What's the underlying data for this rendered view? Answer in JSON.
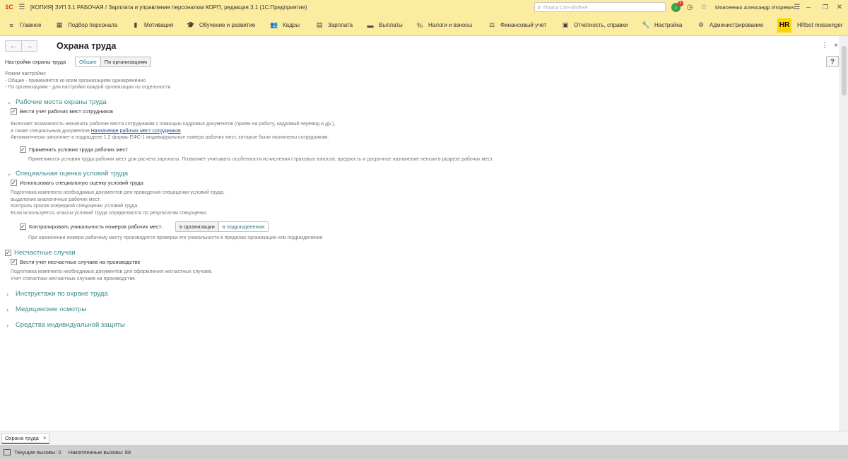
{
  "titlebar": {
    "logo": "1С",
    "title": "[КОПИЯ] ЗУП 3.1 РАБОЧАЯ / Зарплата и управление персоналом КОРП, редакция 3.1  (1С:Предприятие)",
    "search_placeholder": "Поиск Ctrl+Shift+F",
    "notifications_count": "3",
    "user": "Моисеенко Александр Игоревич"
  },
  "menu": {
    "items": [
      {
        "label": "Главное",
        "icon": "menu-icon"
      },
      {
        "label": "Подбор персонала",
        "icon": "recruiting-icon"
      },
      {
        "label": "Мотивация",
        "icon": "motivation-icon"
      },
      {
        "label": "Обучение и развитие",
        "icon": "graduation-icon"
      },
      {
        "label": "Кадры",
        "icon": "people-icon"
      },
      {
        "label": "Зарплата",
        "icon": "calculator-icon"
      },
      {
        "label": "Выплаты",
        "icon": "wallet-icon"
      },
      {
        "label": "Налоги и взносы",
        "icon": "percent-icon"
      },
      {
        "label": "Финансовый учет",
        "icon": "scales-icon"
      },
      {
        "label": "Отчетность, справки",
        "icon": "reports-icon"
      },
      {
        "label": "Настройка",
        "icon": "wrench-icon"
      },
      {
        "label": "Администрирование",
        "icon": "gear-icon"
      }
    ],
    "hr_badge": "HR",
    "hrbot": "HRbot messenger"
  },
  "form": {
    "title": "Охрана труда",
    "settings_label": "Настройки охраны труда",
    "mode_tabs": [
      "Общие",
      "По организациям"
    ],
    "mode_help": [
      "Режим настройки:",
      "- Общие - применяется ко всем организациям одновременно",
      "- По организациям - для настройки каждой организации по отдельности"
    ],
    "help_button": "?",
    "groups": {
      "workplaces": {
        "title": "Рабочие места охраны труда",
        "checkbox": "Вести учет рабочих мест сотрудников",
        "desc1": "Включает возможность назначать рабочие места сотрудникам с помощью кадровых документов (прием на работу, кадровый перевод и др.),",
        "desc2": "а также специальным документом",
        "link": "Назначение рабочих мест сотрудников",
        "desc3": "Автоматически заполняет в подразделе 1.2 формы ЕФС-1 индивидуальные номера рабочих мест, которые были назначены сотрудникам.",
        "sub_checkbox": "Применять условия труда рабочих мест",
        "sub_desc": "Применяются условия труда рабочих мест для расчета зарплаты. Позволяет учитывать особенности исчисления страховых взносов, вредность и досрочное назначение пенсии в разрезе рабочих мест."
      },
      "assessment": {
        "title": "Специальная оценка условий труда",
        "checkbox": "Использовать специальную оценку условий труда",
        "desc": [
          "Подготовка комплекта необходимых документов для проведения спецоценки условий труда,",
          "выделение аналогичных рабочих мест.",
          "Контроль сроков очередной спецоценки условий труда.",
          "Если используется, классы условий труда определяются по результатам спецоценки."
        ],
        "sub_checkbox": "Контролировать уникальность номеров рабочих мест:",
        "scope_options": [
          "в организации",
          "в подразделении"
        ],
        "sub_desc": "При назначении номера рабочему месту производится проверка его уникальности в пределах организации или подразделения"
      },
      "accidents": {
        "title": "Несчастные случаи",
        "checkbox": "Вести учет несчастных случаев на производстве",
        "desc": [
          "Подготовка комплекта необходимых документов для оформления несчастных случаев.",
          "Учет статистики несчастных случаев на производстве."
        ]
      },
      "collapsed": [
        "Инструктажи по охране труда",
        "Медицинские осмотры",
        "Средства индивидуальной защиты"
      ]
    }
  },
  "tabbar": {
    "tab": "Охрана труда"
  },
  "status": {
    "current_calls": "Текущие вызовы: 0",
    "accumulated_calls": "Накопленные вызовы: 88"
  }
}
